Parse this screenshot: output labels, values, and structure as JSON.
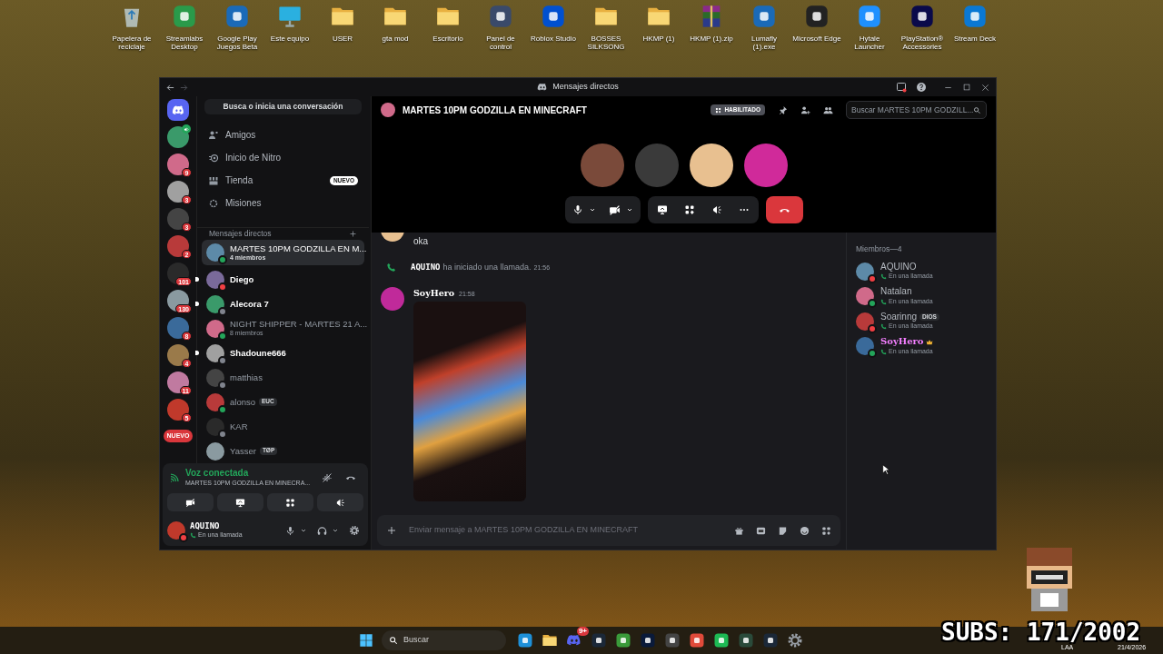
{
  "desktop_icons": [
    {
      "label": "Papelera de reciclaje",
      "kind": "recycle"
    },
    {
      "label": "Streamlabs Desktop",
      "kind": "app"
    },
    {
      "label": "Google Play Juegos Beta",
      "kind": "app"
    },
    {
      "label": "Este equipo",
      "kind": "monitor"
    },
    {
      "label": "USER",
      "kind": "folder"
    },
    {
      "label": "gta mod",
      "kind": "folder"
    },
    {
      "label": "Escritorio",
      "kind": "folder"
    },
    {
      "label": "Panel de control",
      "kind": "app"
    },
    {
      "label": "Roblox Studio",
      "kind": "app"
    },
    {
      "label": "BOSSES SILKSONG",
      "kind": "folder"
    },
    {
      "label": "HKMP (1)",
      "kind": "folder"
    },
    {
      "label": "HKMP (1).zip",
      "kind": "archive"
    },
    {
      "label": "Lumafly (1).exe",
      "kind": "app"
    },
    {
      "label": "Microsoft Edge",
      "kind": "app"
    },
    {
      "label": "Hytale Launcher",
      "kind": "app"
    },
    {
      "label": "PlayStation® Accessories",
      "kind": "app"
    },
    {
      "label": "Stream Deck",
      "kind": "app"
    }
  ],
  "window": {
    "title": "Mensajes directos"
  },
  "servers": [
    {
      "kind": "voice"
    },
    {
      "kind": "server",
      "badge": "9"
    },
    {
      "kind": "server",
      "badge": "3"
    },
    {
      "kind": "server",
      "badge": "3"
    },
    {
      "kind": "server",
      "badge": "2"
    },
    {
      "kind": "server",
      "badge": "101"
    },
    {
      "kind": "server",
      "badge": "130"
    },
    {
      "kind": "server",
      "badge": "8"
    },
    {
      "kind": "server",
      "badge": "4"
    },
    {
      "kind": "server",
      "badge": "11"
    },
    {
      "kind": "server",
      "badge": "5"
    },
    {
      "kind": "new",
      "label": "NUEVO"
    }
  ],
  "dm_search": "Busca o inicia una conversación",
  "nav": [
    {
      "label": "Amigos"
    },
    {
      "label": "Inicio de Nitro"
    },
    {
      "label": "Tienda",
      "badge": "NUEVO"
    },
    {
      "label": "Misiones"
    }
  ],
  "dm_header": "Mensajes directos",
  "dms": [
    {
      "name": "MARTES 10PM GODZILLA EN M...",
      "subtitle": "4 miembros",
      "selected": true,
      "unread": false,
      "color": "#23a55a"
    },
    {
      "name": "Diego",
      "selected": false,
      "unread": true,
      "color": "#f23f43"
    },
    {
      "name": "Alecora 7",
      "selected": false,
      "unread": true,
      "color": "#80848e"
    },
    {
      "name": "NIGHT SHIPPER - MARTES 21 A...",
      "subtitle": "8 miembros",
      "selected": false,
      "unread": false,
      "color": "#23a55a"
    },
    {
      "name": "Shadoune666",
      "selected": false,
      "unread": true,
      "color": "#80848e"
    },
    {
      "name": "matthias",
      "selected": false,
      "unread": false,
      "color": "#80848e"
    },
    {
      "name": "alonso",
      "tag": "EUC",
      "selected": false,
      "unread": false,
      "color": "#23a55a"
    },
    {
      "name": "KAR",
      "selected": false,
      "unread": false,
      "color": "#80848e"
    },
    {
      "name": "Yasser",
      "tag": "TØP",
      "selected": false,
      "unread": false
    }
  ],
  "voice": {
    "status": "Voz conectada",
    "channel": "MARTES 10PM GODZILLA EN MINECRA..."
  },
  "user": {
    "name": "AQUINO",
    "status": "En una llamada",
    "color": "#f23f43"
  },
  "channel": {
    "title": "MARTES 10PM GODZILLA EN MINECRAFT",
    "badge": "HABILITADO",
    "search": {
      "placeholder": "Buscar MARTES 10PM GODZILL..."
    }
  },
  "messages": [
    {
      "kind": "text",
      "text": "oka"
    },
    {
      "kind": "system",
      "author": "AQUINO",
      "text": "ha iniciado una llamada.",
      "time": "21:56"
    },
    {
      "kind": "image",
      "author": "SoyHero",
      "time": "21:58"
    }
  ],
  "composer": {
    "placeholder": "Enviar mensaje a MARTES 10PM GODZILLA EN MINECRAFT"
  },
  "members": {
    "title": "Miembros—4",
    "items": [
      {
        "name": "AQUINO",
        "status": "En una llamada",
        "owner": false,
        "color": "#f23f43"
      },
      {
        "name": "Natalan",
        "status": "En una llamada",
        "owner": false,
        "color": "#23a55a"
      },
      {
        "name": "Soarinng",
        "tag": "DIOS",
        "status": "En una llamada",
        "owner": false,
        "color": "#f23f43"
      },
      {
        "name": "SoyHero",
        "status": "En una llamada",
        "owner": true,
        "color": "#23a55a"
      }
    ]
  },
  "taskbar": {
    "search": {
      "placeholder": "Buscar"
    },
    "discord_badge": "9+",
    "language": "LAA",
    "date": "21/4/2026"
  },
  "overlay": {
    "subs": "SUBS: 171/2002"
  }
}
